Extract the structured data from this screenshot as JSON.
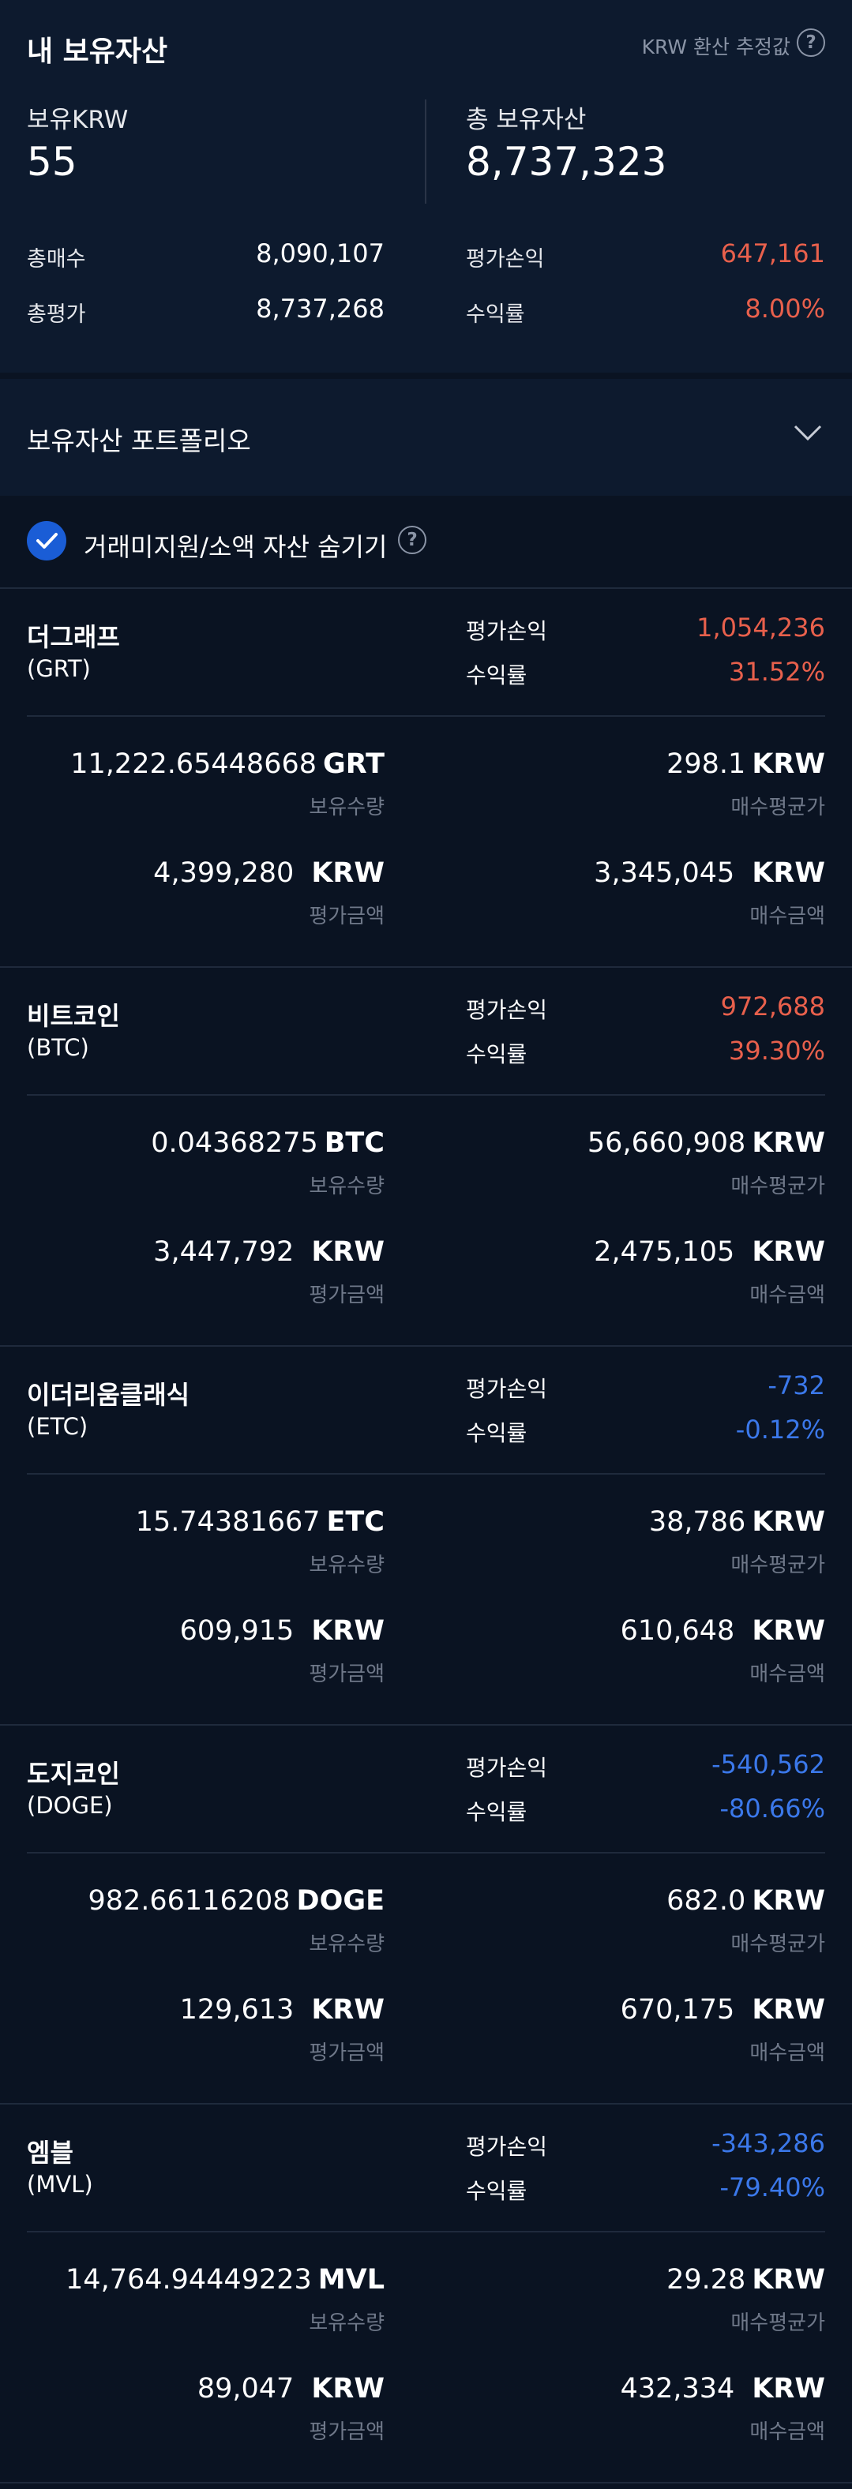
{
  "header": {
    "title": "내 보유자산",
    "krw_hint": "KRW 환산 추정값",
    "help_glyph": "?"
  },
  "summary": {
    "krw_label": "보유KRW",
    "krw_value": "55",
    "total_label": "총 보유자산",
    "total_value": "8,737,323",
    "buy_total_label": "총매수",
    "buy_total_value": "8,090,107",
    "eval_total_label": "총평가",
    "eval_total_value": "8,737,268",
    "pl_label": "평가손익",
    "pl_value": "647,161",
    "rate_label": "수익률",
    "rate_value": "8.00%"
  },
  "portfolio": {
    "label": "보유자산 포트폴리오"
  },
  "hide_filter": {
    "label": "거래미지원/소액 자산 숨기기",
    "checked": true
  },
  "labels": {
    "pl": "평가손익",
    "rate": "수익률",
    "qty": "보유수량",
    "avg_price": "매수평균가",
    "eval_amount": "평가금액",
    "buy_amount": "매수금액",
    "krw": "KRW"
  },
  "assets": [
    {
      "name": "더그래프",
      "symbol": "(GRT)",
      "pl": "1,054,236",
      "rate": "31.52%",
      "qty": "11,222.65448668",
      "qty_unit": "GRT",
      "avg_price": "298.1",
      "eval_amount": "4,399,280",
      "buy_amount": "3,345,045",
      "trend_color": "#e8604c"
    },
    {
      "name": "비트코인",
      "symbol": "(BTC)",
      "pl": "972,688",
      "rate": "39.30%",
      "qty": "0.04368275",
      "qty_unit": "BTC",
      "avg_price": "56,660,908",
      "eval_amount": "3,447,792",
      "buy_amount": "2,475,105",
      "trend_color": "#e8604c"
    },
    {
      "name": "이더리움클래식",
      "symbol": "(ETC)",
      "pl": "-732",
      "rate": "-0.12%",
      "qty": "15.74381667",
      "qty_unit": "ETC",
      "avg_price": "38,786",
      "eval_amount": "609,915",
      "buy_amount": "610,648",
      "trend_color": "#3b78ea"
    },
    {
      "name": "도지코인",
      "symbol": "(DOGE)",
      "pl": "-540,562",
      "rate": "-80.66%",
      "qty": "982.66116208",
      "qty_unit": "DOGE",
      "avg_price": "682.0",
      "eval_amount": "129,613",
      "buy_amount": "670,175",
      "trend_color": "#3b78ea"
    },
    {
      "name": "엠블",
      "symbol": "(MVL)",
      "pl": "-343,286",
      "rate": "-79.40%",
      "qty": "14,764.94449223",
      "qty_unit": "MVL",
      "avg_price": "29.28",
      "eval_amount": "89,047",
      "buy_amount": "432,334",
      "trend_color": "#3b78ea"
    }
  ]
}
